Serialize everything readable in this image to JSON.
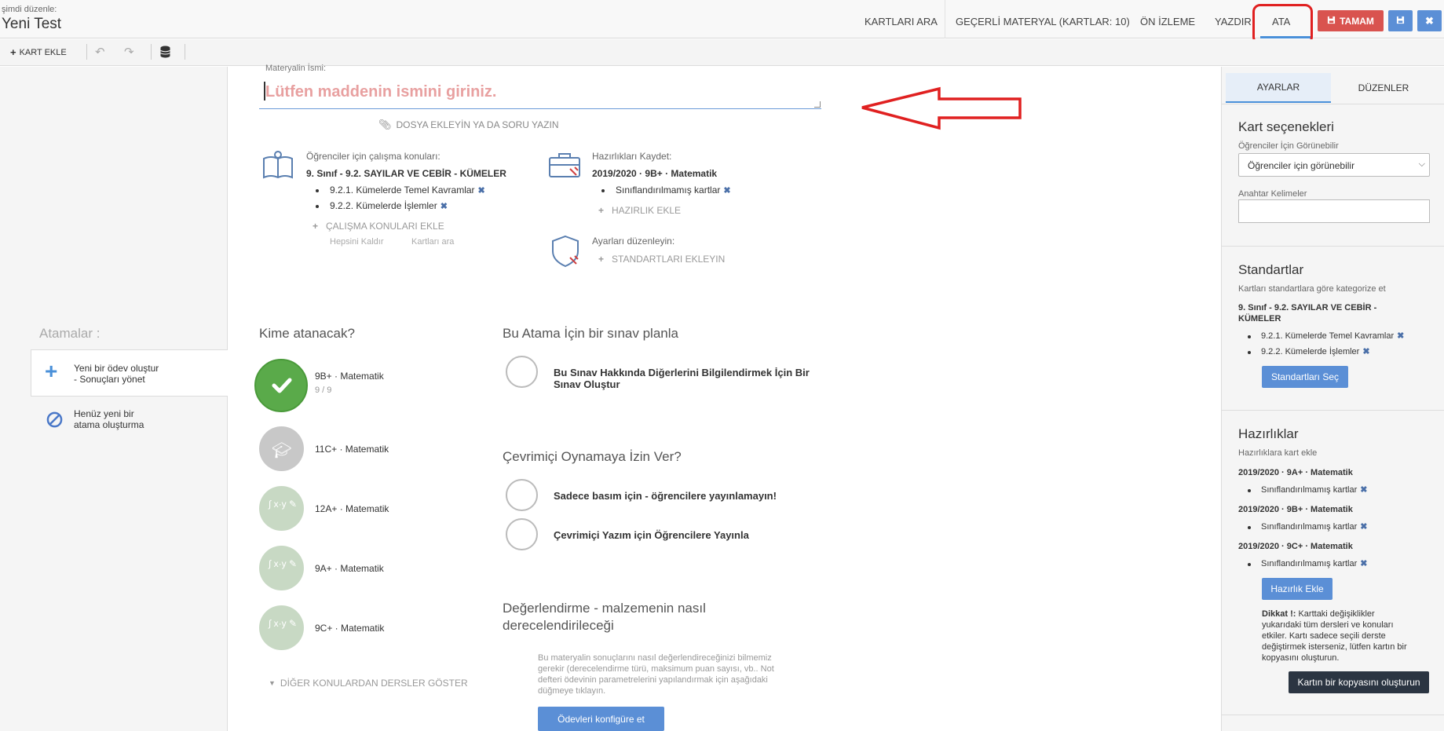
{
  "header": {
    "edit_label": "şimdi düzenle:",
    "title": "Yeni Test",
    "nav": {
      "search_cards": "KARTLARI ARA",
      "current_material": "GEÇERLİ MATERYAL (KARTLAR: 10)",
      "preview": "ÖN İZLEME",
      "print": "YAZDIR",
      "assign": "ATA"
    },
    "done_label": "TAMAM"
  },
  "toolbar": {
    "add_card": "KART EKLE"
  },
  "left": {
    "assignments_label": "Atamalar :",
    "create_item": {
      "line1": "Yeni bir ödev oluştur",
      "line2": "- Sonuçları yönet"
    },
    "none_item": {
      "line1": "Henüz yeni bir",
      "line2": "atama oluşturma"
    }
  },
  "material": {
    "name_label": "Materyalin İsmi:",
    "name_placeholder": "Lütfen maddenin ismini giriniz.",
    "attach_label": "DOSYA EKLEYİN YA DA SORU YAZIN",
    "topics": {
      "label": "Öğrenciler için çalışma konuları:",
      "heading": "9. Sınıf - 9.2. SAYILAR VE CEBİR - KÜMELER",
      "items": [
        "9.2.1. Kümelerde Temel Kavramlar",
        "9.2.2. Kümelerde İşlemler"
      ],
      "add": "ÇALIŞMA KONULARI EKLE",
      "remove_all": "Hepsini Kaldır",
      "search": "Kartları ara"
    },
    "prep": {
      "label": "Hazırlıkları Kaydet:",
      "heading": "2019/2020 · 9B+ · Matematik",
      "items": [
        "Sınıflandırılmamış kartlar"
      ],
      "add": "HAZIRLIK EKLE"
    },
    "settings": {
      "label": "Ayarları düzenleyin:",
      "add": "STANDARTLARI EKLEYIN"
    }
  },
  "assign": {
    "title": "Kime atanacak?",
    "classes": [
      {
        "name": "9B+ · Matematik",
        "count": "9 / 9"
      },
      {
        "name": "11C+ · Matematik",
        "count": ""
      },
      {
        "name": "12A+ · Matematik",
        "count": ""
      },
      {
        "name": "9A+ · Matematik",
        "count": ""
      },
      {
        "name": "9C+ · Matematik",
        "count": ""
      }
    ],
    "show_other": "DİĞER KONULARDAN DERSLER GÖSTER"
  },
  "exam": {
    "title": "Bu Atama İçin bir sınav planla",
    "option_line1": "Bu Sınav Hakkında Diğerlerini Bilgilendirmek İçin Bir",
    "option_line2": "Sınav Oluştur"
  },
  "online": {
    "title": "Çevrimiçi Oynamaya İzin Ver?",
    "options": [
      "Sadece basım için - öğrencilere yayınlamayın!",
      "Çevrimiçi Yazım için Öğrencilere Yayınla"
    ]
  },
  "grading": {
    "title_line1": "Değerlendirme - malzemenin nasıl",
    "title_line2": "derecelendirileceği",
    "desc_lines": [
      "Bu materyalin sonuçlarını nasıl değerlendireceğinizi bilmemiz",
      "gerekir (derecelendirme türü, maksimum puan sayısı, vb.. Not",
      "defteri ödevinin parametrelerini yapılandırmak için aşağıdaki",
      "düğmeye tıklayın."
    ],
    "button": "Ödevleri konfigüre et"
  },
  "right": {
    "tabs": [
      "AYARLAR",
      "DÜZENLER"
    ],
    "card_options": {
      "title": "Kart seçenekleri",
      "visible_label": "Öğrenciler İçin Görünebilir",
      "visible_value": "Öğrenciler için görünebilir",
      "keywords_label": "Anahtar Kelimeler",
      "keywords_value": ""
    },
    "standards": {
      "title": "Standartlar",
      "subtitle": "Kartları standartlara göre kategorize et",
      "heading_line1": "9. Sınıf - 9.2. SAYILAR VE CEBİR -",
      "heading_line2": "KÜMELER",
      "items": [
        "9.2.1. Kümelerde Temel Kavramlar",
        "9.2.2. Kümelerde İşlemler"
      ],
      "button": "Standartları Seç"
    },
    "preps": {
      "title": "Hazırlıklar",
      "subtitle": "Hazırlıklara kart ekle",
      "groups": [
        {
          "heading": "2019/2020 · 9A+ · Matematik",
          "item": "Sınıflandırılmamış kartlar"
        },
        {
          "heading": "2019/2020 · 9B+ · Matematik",
          "item": "Sınıflandırılmamış kartlar"
        },
        {
          "heading": "2019/2020 · 9C+ · Matematik",
          "item": "Sınıflandırılmamış kartlar"
        }
      ],
      "button": "Hazırlık Ekle",
      "note_bold": "Dikkat !:",
      "note_lines": [
        " Karttaki değişiklikler",
        "yukarıdaki tüm dersleri ve konuları",
        "etkiler. Kartı sadece seçili derste",
        "değiştirmek isterseniz, lütfen kartın bir",
        "kopyasını oluşturun."
      ],
      "copy_button": "Kartın bir kopyasını oluşturun"
    }
  },
  "colors": {
    "accent": "#4a90d9",
    "danger": "#d9534f",
    "save": "#5b8fd6",
    "highlight": "#e02020",
    "primary_btn": "#5b8fd6",
    "dark_btn": "#2b3542"
  }
}
